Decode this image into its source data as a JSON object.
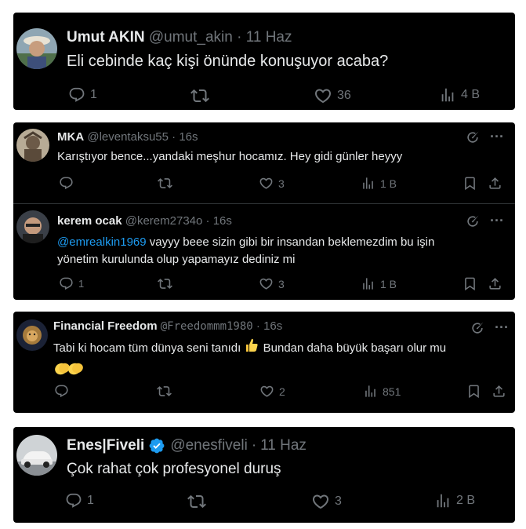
{
  "tweets": [
    {
      "name": "Umut AKIN",
      "handle": "@umut_akin",
      "dot": "·",
      "time": "11 Haz",
      "text": "Eli cebinde kaç kişi önünde konuşuyor acaba?",
      "replies": "1",
      "retweets": "",
      "likes": "36",
      "views": "4 B"
    },
    {
      "name": "MKA",
      "handle": "@leventaksu55",
      "dot": "·",
      "time": "16s",
      "text": "Karıştıyor bence...yandaki meşhur hocamız.  Hey gidi günler heyyy",
      "replies": "",
      "retweets": "",
      "likes": "3",
      "views": "1 B"
    },
    {
      "name": "kerem ocak",
      "handle": "@kerem2734o",
      "dot": "·",
      "time": "16s",
      "mention": "@emrealkin1969",
      "text_after_mention": "  vayyy beee sizin gibi bir insandan beklemezdim bu işin",
      "text_line2": "yönetim kurulunda olup yapamayız dediniz mi",
      "replies": "1",
      "retweets": "",
      "likes": "3",
      "views": "1 B"
    },
    {
      "name": "Financial Freedom",
      "handle": "@Freedommm1980",
      "dot": "·",
      "time": "16s",
      "text_before_emoji": "Tabi ki hocam tüm dünya seni tanıdı",
      "text_after_emoji": " Bundan daha büyük başarı olur mu",
      "replies": "",
      "retweets": "",
      "likes": "2",
      "views": "851"
    },
    {
      "name": "Enes|Fiveli",
      "handle": "@enesfiveli",
      "dot": "·",
      "time": "11 Haz",
      "text": "Çok rahat çok profesyonel duruş",
      "replies": "1",
      "retweets": "",
      "likes": "3",
      "views": "2 B"
    }
  ],
  "icons": {
    "more": "···"
  },
  "colors": {
    "background": "#000000",
    "text": "#e7e9ea",
    "muted": "#71767b",
    "link": "#1d9bf0",
    "verified": "#1d9bf0"
  }
}
